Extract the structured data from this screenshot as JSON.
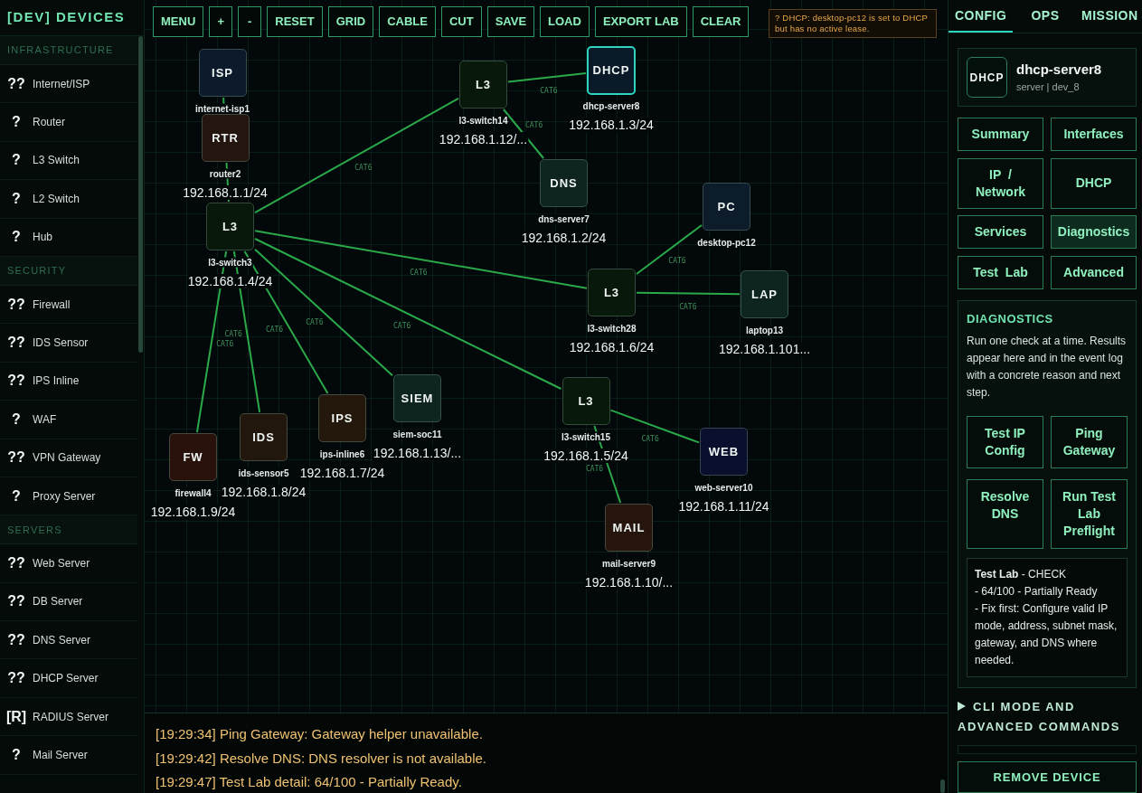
{
  "sidebar": {
    "title": "[DEV] DEVICES",
    "sections": [
      {
        "title": "INFRASTRUCTURE",
        "items": [
          {
            "icon": "??",
            "label": "Internet/ISP"
          },
          {
            "icon": "?",
            "label": "Router"
          },
          {
            "icon": "?",
            "label": "L3 Switch"
          },
          {
            "icon": "?",
            "label": "L2 Switch"
          },
          {
            "icon": "?",
            "label": "Hub"
          }
        ]
      },
      {
        "title": "SECURITY",
        "items": [
          {
            "icon": "??",
            "label": "Firewall"
          },
          {
            "icon": "??",
            "label": "IDS Sensor"
          },
          {
            "icon": "??",
            "label": "IPS Inline"
          },
          {
            "icon": "?",
            "label": "WAF"
          },
          {
            "icon": "??",
            "label": "VPN Gateway"
          },
          {
            "icon": "?",
            "label": "Proxy Server"
          }
        ]
      },
      {
        "title": "SERVERS",
        "items": [
          {
            "icon": "??",
            "label": "Web Server"
          },
          {
            "icon": "??",
            "label": "DB Server"
          },
          {
            "icon": "??",
            "label": "DNS Server"
          },
          {
            "icon": "??",
            "label": "DHCP Server"
          },
          {
            "icon": "[R]",
            "label": "RADIUS Server"
          },
          {
            "icon": "?",
            "label": "Mail Server"
          }
        ]
      }
    ]
  },
  "toolbar": {
    "buttons": [
      "MENU",
      "+",
      "-",
      "RESET",
      "GRID",
      "CABLE",
      "CUT",
      "SAVE",
      "LOAD",
      "EXPORT LAB",
      "CLEAR"
    ]
  },
  "alert": {
    "text": "? DHCP: desktop-pc12 is set to DHCP but has no active lease."
  },
  "canvas": {
    "nodes": [
      {
        "badge": "ISP",
        "name": "internet-isp1",
        "color": "#0d1a2c",
        "selected": false
      },
      {
        "badge": "RTR",
        "name": "router2",
        "ip": "192.168.1.1/24",
        "color": "#24150e",
        "selected": false
      },
      {
        "badge": "L3",
        "name": "l3-switch3",
        "ip": "192.168.1.4/24",
        "color": "#08190b",
        "selected": false
      },
      {
        "badge": "L3",
        "name": "l3-switch14",
        "ip": "192.168.1.12/...",
        "color": "#08190b",
        "selected": false
      },
      {
        "badge": "DHCP",
        "name": "dhcp-server8",
        "ip": "192.168.1.3/24",
        "color": "#0a1a28",
        "selected": true
      },
      {
        "badge": "DNS",
        "name": "dns-server7",
        "ip": "192.168.1.2/24",
        "color": "#0d2420",
        "selected": false
      },
      {
        "badge": "PC",
        "name": "desktop-pc12",
        "color": "#0c1c2a",
        "selected": false
      },
      {
        "badge": "L3",
        "name": "l3-switch28",
        "ip": "192.168.1.6/24",
        "color": "#08190b",
        "selected": false
      },
      {
        "badge": "LAP",
        "name": "laptop13",
        "ip": "192.168.1.101...",
        "color": "#0d2420",
        "selected": false
      },
      {
        "badge": "SIEM",
        "name": "siem-soc11",
        "ip": "192.168.1.13/...",
        "color": "#0d2420",
        "selected": false
      },
      {
        "badge": "L3",
        "name": "l3-switch15",
        "ip": "192.168.1.5/24",
        "color": "#08190b",
        "selected": false
      },
      {
        "badge": "IPS",
        "name": "ips-inline6",
        "ip": "192.168.1.7/24",
        "color": "#24180c",
        "selected": false
      },
      {
        "badge": "IDS",
        "name": "ids-sensor5",
        "ip": "192.168.1.8/24",
        "color": "#22170c",
        "selected": false
      },
      {
        "badge": "FW",
        "name": "firewall4",
        "ip": "192.168.1.9/24",
        "color": "#29120c",
        "selected": false
      },
      {
        "badge": "WEB",
        "name": "web-server10",
        "ip": "192.168.1.11/24",
        "color": "#090f2c",
        "selected": false
      },
      {
        "badge": "MAIL",
        "name": "mail-server9",
        "ip": "192.168.1.10/...",
        "color": "#25150c",
        "selected": false
      }
    ],
    "links": [
      {
        "kind": "cable"
      },
      {
        "kind": "cable"
      },
      {
        "kind": "cable",
        "label": "CAT6"
      },
      {
        "kind": "cable",
        "label": "CAT6"
      },
      {
        "kind": "cable",
        "label": "CAT6"
      },
      {
        "kind": "cable",
        "label": "CAT6"
      },
      {
        "kind": "cable",
        "label": "CAT6"
      },
      {
        "kind": "cable",
        "label": "CAT6"
      },
      {
        "kind": "cable",
        "label": "CAT6"
      },
      {
        "kind": "cable",
        "label": "CAT6"
      },
      {
        "kind": "cable",
        "label": "CAT6"
      },
      {
        "kind": "cable",
        "label": "CAT6"
      },
      {
        "kind": "cable",
        "label": "CAT6"
      },
      {
        "kind": "cable",
        "label": "CAT6"
      },
      {
        "kind": "cable",
        "label": "CAT6"
      }
    ]
  },
  "event_log": [
    "[19:29:34] Ping Gateway: Gateway helper unavailable.",
    "[19:29:42] Resolve DNS: DNS resolver is not available.",
    "[19:29:47] Test Lab detail: 64/100 - Partially Ready."
  ],
  "inspector": {
    "tabs": [
      {
        "label": "CONFIG",
        "selected": true
      },
      {
        "label": "OPS",
        "selected": false
      },
      {
        "label": "MISSION",
        "selected": false
      }
    ],
    "device": {
      "badge": "DHCP",
      "name": "dhcp-server8",
      "subtitle": "server | dev_8"
    },
    "sections": [
      {
        "label": "Summary",
        "selected": false
      },
      {
        "label": "Interfaces",
        "selected": false
      },
      {
        "label": "IP / Network",
        "selected": false
      },
      {
        "label": "DHCP",
        "selected": false
      },
      {
        "label": "Services",
        "selected": false
      },
      {
        "label": "Diagnostics",
        "selected": true
      },
      {
        "label": "Test Lab",
        "selected": false
      },
      {
        "label": "Advanced",
        "selected": false
      }
    ],
    "diagnostics": {
      "title": "DIAGNOSTICS",
      "description": "Run one check at a time. Results appear here and in the event log with a concrete reason and next step.",
      "buttons": [
        "Test IP Config",
        "Ping Gateway",
        "Resolve DNS",
        "Run Test Lab Preflight"
      ],
      "result": "**Test Lab** - CHECK\n- 64/100 - Partially Ready\n- Fix first: Configure valid IP mode, address, subnet mask, gateway, and DNS where needed."
    },
    "cli": {
      "title": "CLI MODE AND ADVANCED COMMANDS",
      "expanded": false
    },
    "remove_button": "REMOVE DEVICE"
  }
}
